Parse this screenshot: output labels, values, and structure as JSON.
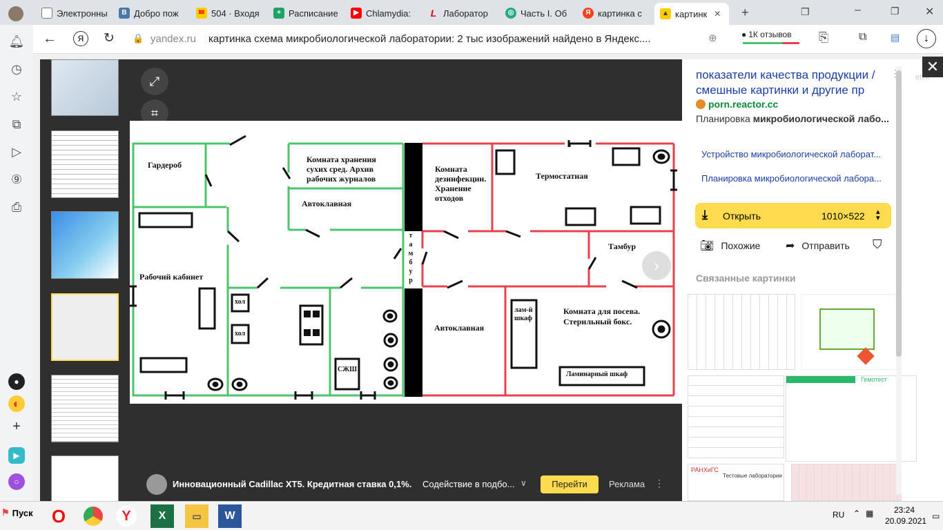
{
  "tabs": [
    {
      "label": "Электронны",
      "icon": "page-icon"
    },
    {
      "label": "Добро пож",
      "icon": "vk-icon"
    },
    {
      "label": "504 · Входя",
      "icon": "mail-icon"
    },
    {
      "label": "Расписание",
      "icon": "plus-calendar-icon"
    },
    {
      "label": "Chlamydia:",
      "icon": "youtube-icon"
    },
    {
      "label": "Лаборатор",
      "icon": "l-icon"
    },
    {
      "label": "Часть I. Об",
      "icon": "globe-icon"
    },
    {
      "label": "картинка с",
      "icon": "yandex-icon"
    },
    {
      "label": "картинк",
      "icon": "image-icon",
      "active": true
    }
  ],
  "address": {
    "domain": "yandex.ru",
    "title": "картинка схема микробиологической лаборатории: 2 тыс изображений найдено в Яндекс....",
    "reviews": "1К отзывов"
  },
  "plan": {
    "rooms": {
      "garderob": "Гардероб",
      "storage": "Комната хранения сухих сред. Архив рабочих журналов",
      "autoclave1": "Автоклавная",
      "disinf": "Комната дезинфекции. Хранение отходов",
      "thermo": "Термостатная",
      "tambur1": "Тамбур",
      "tambur_vertical": [
        "т",
        "а",
        "м",
        "б",
        "у",
        "р"
      ],
      "office": "Рабочий кабинет",
      "hol1": "хол",
      "hol2": "хол",
      "szsh": "СЖШ",
      "autoclave2": "Автоклавная",
      "lam_shkaf": "лам-й шкаф",
      "posev": "Комната для посева. Стерильный бокс.",
      "lam_shkaf2": "Ламинарный шкаф"
    }
  },
  "ad": {
    "text": "Инновационный Cadillac XT5. Кредитная ставка 0,1%.",
    "sub": "Содействие в подбо...",
    "button": "Перейти",
    "label": "Реклама"
  },
  "panel": {
    "title": "показатели качества продукции / смешные картинки и другие пр",
    "source": "porn.reactor.cc",
    "subtitle_prefix": "Планировка ",
    "subtitle_bold": "микробиологической лабо...",
    "links": [
      "Устройство микробиологической лаборат...",
      "Планировка микробиологической лаборa..."
    ],
    "open_label": "Открыть",
    "size": "1010×522",
    "similar": "Похожие",
    "share": "Отправить",
    "related": "Связанные картинки",
    "rel_caption": "Тестовые лаборатории",
    "rel_logo": "РАНХиГС",
    "rel_brand": "Гемотест",
    "cutoff": "etok"
  },
  "taskbar": {
    "start": "Пуск",
    "lang": "RU",
    "time": "23:24",
    "date": "20.09.2021"
  },
  "colors": {
    "green": "#4cc46a",
    "red": "#e8404e",
    "yellow": "#ffdb4d"
  }
}
